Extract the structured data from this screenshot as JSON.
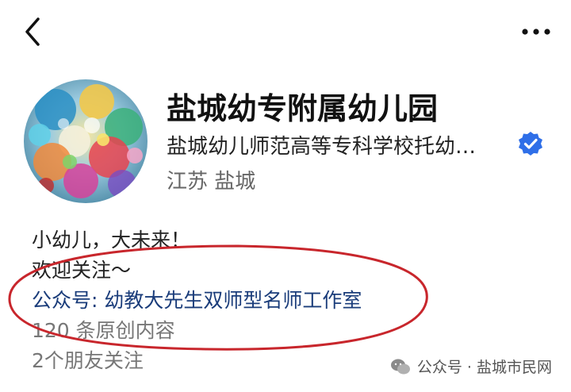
{
  "header": {
    "back_icon": "chevron-left-icon",
    "more_icon": "more-dots-icon"
  },
  "profile": {
    "name": "盐城幼专附属幼儿园",
    "verified_org": "盐城幼儿师范高等专科学校托幼…",
    "verified_icon": "verified-badge-icon",
    "verified_color": "#2f6fe8",
    "location": "江苏 盐城"
  },
  "bio": {
    "line1": "小幼儿，大未来！",
    "line2": "欢迎关注～",
    "line3": "公众号: 幼教大先生双师型名师工作室",
    "original_count": "120 条原创内容",
    "friends_following": "2个朋友关注"
  },
  "annotation": {
    "oval_color": "#c8262c"
  },
  "watermark": {
    "text": "公众号 · 盐城市民网"
  }
}
